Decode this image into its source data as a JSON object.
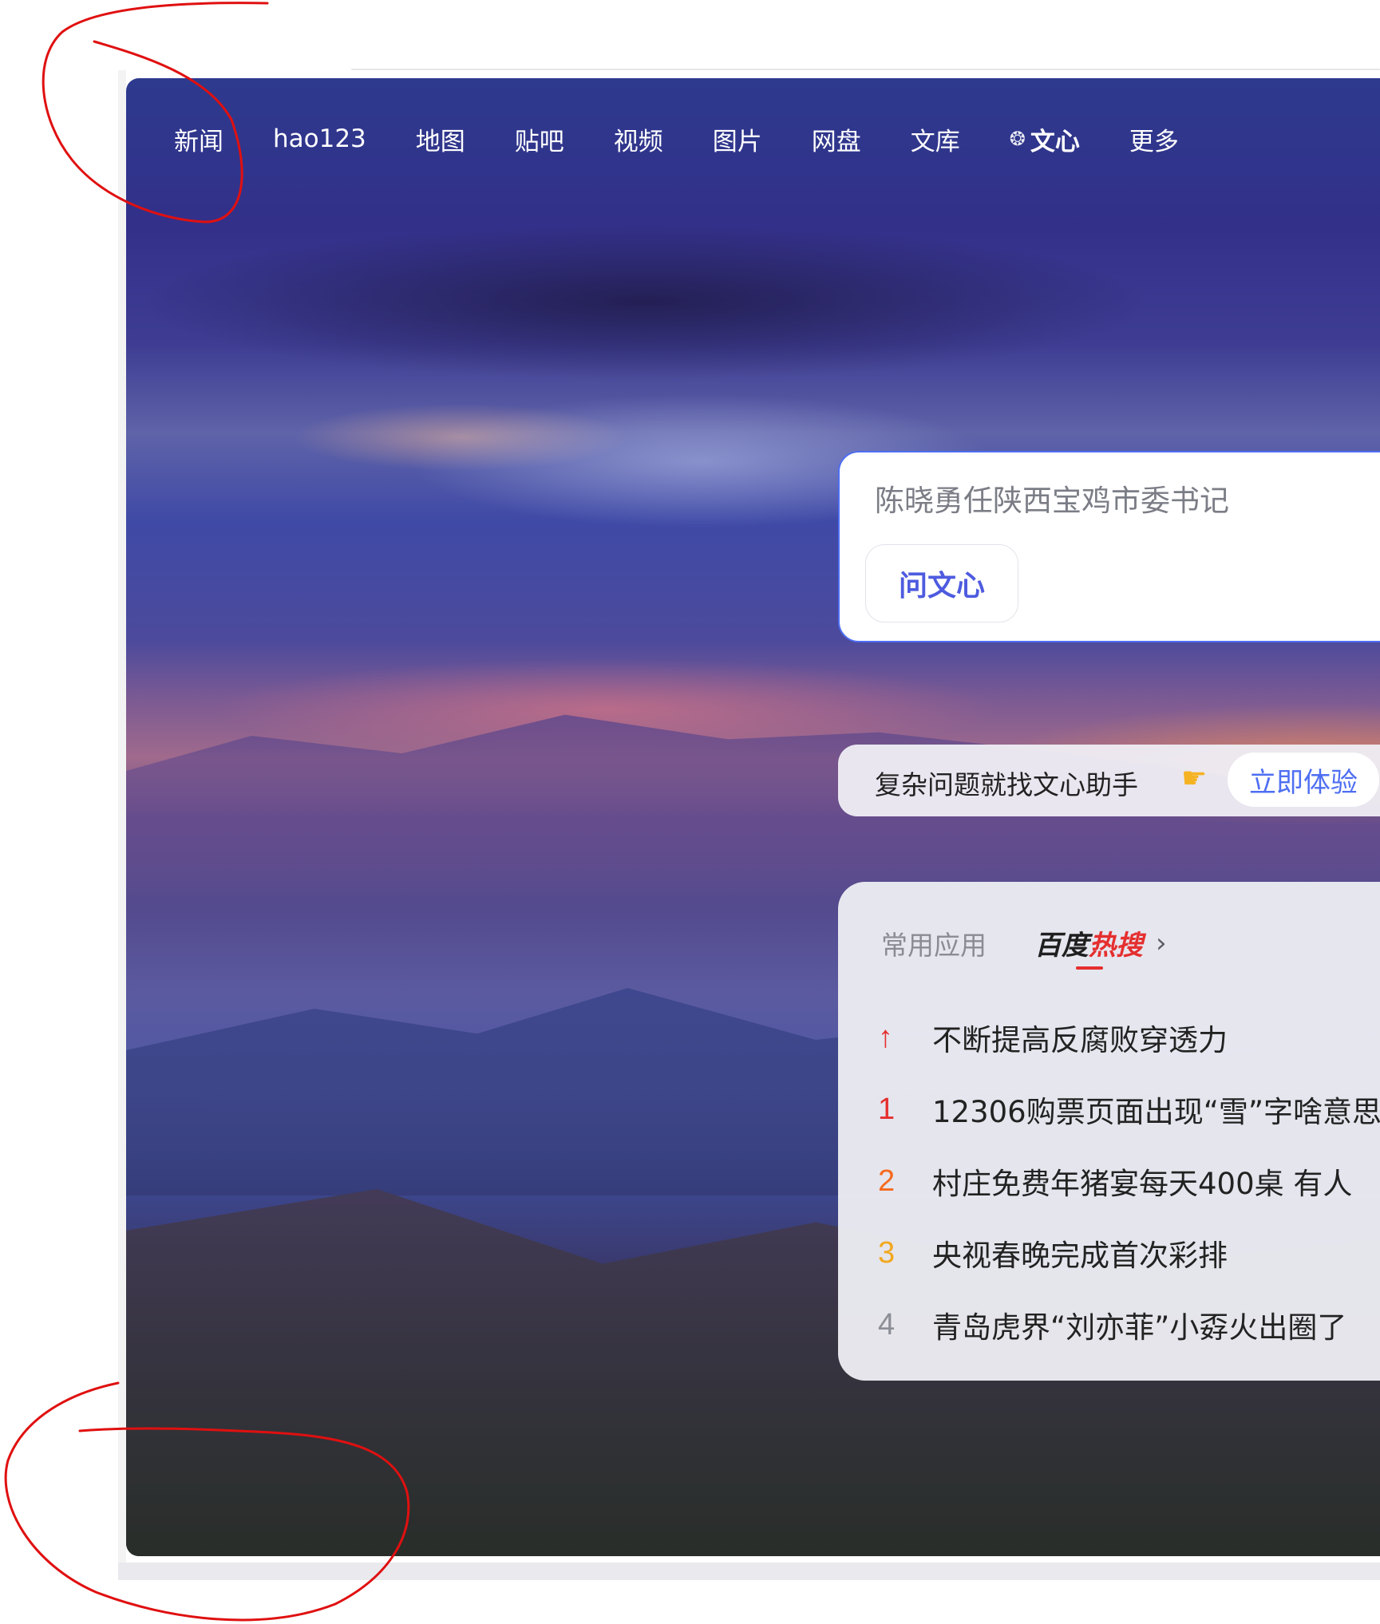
{
  "nav": {
    "items": [
      "新闻",
      "hao123",
      "地图",
      "贴吧",
      "视频",
      "图片",
      "网盘",
      "文库"
    ],
    "wenxin_label": "文心",
    "more_label": "更多"
  },
  "search": {
    "query": "陈晓勇任陕西宝鸡市委书记",
    "ask_button": "问文心"
  },
  "promo": {
    "text": "复杂问题就找文心助手",
    "button": "立即体验"
  },
  "panel": {
    "tab_common": "常用应用",
    "tab_hot_prefix": "百度",
    "tab_hot_accent": "热搜",
    "hot_items": [
      {
        "rank": "↑",
        "title": "不断提高反腐败穿透力"
      },
      {
        "rank": "1",
        "title": "12306购票页面出现“雪”字啥意思"
      },
      {
        "rank": "2",
        "title": "村庄免费年猪宴每天400桌 有人"
      },
      {
        "rank": "3",
        "title": "央视春晚完成首次彩排"
      },
      {
        "rank": "4",
        "title": "青岛虎界“刘亦菲”小孬火出圈了"
      }
    ]
  },
  "colors": {
    "accent": "#4e6ef2",
    "hot_red": "#e52f2f",
    "annotation": "#e01010"
  },
  "icons": {
    "wenxin": "wenxin-logo-icon",
    "hand": "pointing-hand-icon",
    "chevron": "chevron-right-icon",
    "pin": "pinned-top-icon"
  }
}
